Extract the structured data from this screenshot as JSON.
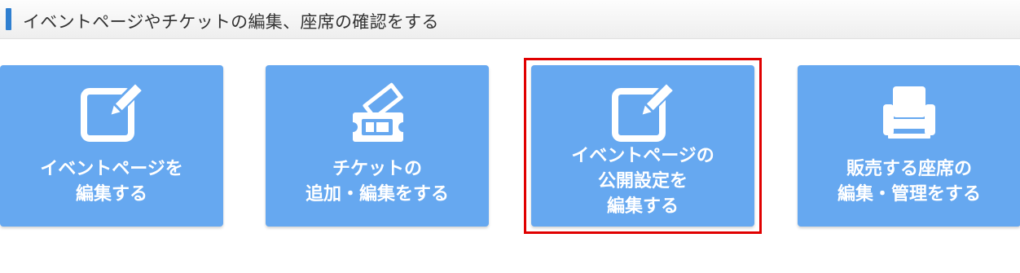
{
  "header": {
    "title": "イベントページやチケットの編集、座席の確認をする",
    "accent_color": "#2f7fd0"
  },
  "tiles": [
    {
      "icon": "edit-pencil-icon",
      "lines": [
        "イベントページを",
        "編集する"
      ]
    },
    {
      "icon": "ticket-icon",
      "lines": [
        "チケットの",
        "追加・編集をする"
      ]
    },
    {
      "icon": "edit-pencil-icon",
      "lines": [
        "イベントページの",
        "公開設定を",
        "編集する"
      ],
      "highlighted": true
    },
    {
      "icon": "seat-icon",
      "lines": [
        "販売する座席の",
        "編集・管理をする"
      ]
    }
  ],
  "colors": {
    "tile_bg": "#66a8f0",
    "highlight": "#e00000"
  }
}
